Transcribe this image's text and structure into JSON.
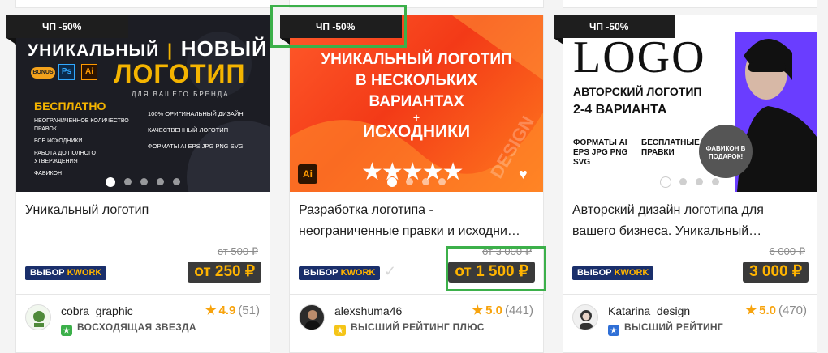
{
  "cards": [
    {
      "badge": "ЧП -50%",
      "cover": {
        "line1a": "УНИКАЛЬНЫЙ",
        "line1b": "НОВЫЙ",
        "line2": "ЛОГОТИП",
        "line3": "ДЛЯ ВАШЕГО БРЕНДА",
        "bonus": "BONUS",
        "free": "БЕСПЛАТНО",
        "left_items": [
          "НЕОГРАНИЧЕННОЕ КОЛИЧЕСТВО ПРАВОК",
          "ВСЕ ИСХОДНИКИ",
          "РАБОТА ДО ПОЛНОГО УТВЕРЖДЕНИЯ",
          "ФАВИКОН"
        ],
        "right_items": [
          "100% ОРИГИНАЛЬНЫЙ ДИЗАЙН",
          "КАЧЕСТВЕННЫЙ ЛОГОТИП",
          "ФОРМАТЫ AI EPS JPG PNG SVG"
        ]
      },
      "title": "Уникальный логотип",
      "old_price": "от 500 ₽",
      "price": "от 250 ₽",
      "choice_a": "ВЫБОР",
      "choice_b": "KWORK",
      "username": "cobra_graphic",
      "rating": "4.9",
      "reviews": "(51)",
      "level": "ВОСХОДЯЩАЯ ЗВЕЗДА"
    },
    {
      "badge": "ЧП -50%",
      "cover": {
        "line1": "УНИКАЛЬНЫЙ ЛОГОТИП",
        "line2": "В НЕСКОЛЬКИХ",
        "line3": "ВАРИАНТАХ",
        "plus": "+",
        "line4": "ИСХОДНИКИ",
        "ai": "Ai",
        "watermark": "DESIGN"
      },
      "title": "Разработка логотипа - неограниченные правки и исходни…",
      "old_price": "от 3 000 ₽",
      "price": "от 1 500 ₽",
      "choice_a": "ВЫБОР",
      "choice_b": "KWORK",
      "check": "✓",
      "username": "alexshuma46",
      "rating": "5.0",
      "reviews": "(441)",
      "level": "ВЫСШИЙ РЕЙТИНГ ПЛЮС"
    },
    {
      "badge": "ЧП -50%",
      "cover": {
        "logo": "LOGO",
        "author": "АВТОРСКИЙ ЛОГОТИП",
        "variants": "2-4 ВАРИАНТА",
        "formats": "ФОРМАТЫ AI EPS JPG PNG SVG",
        "edits": "БЕСПЛАТНЫЕ ПРАВКИ",
        "gift": "ФАВИКОН В ПОДАРОК!"
      },
      "title": "Авторский дизайн логотипа для вашего бизнеса. Уникальный…",
      "old_price": "6 000 ₽",
      "price": "3 000 ₽",
      "choice_a": "ВЫБОР",
      "choice_b": "KWORK",
      "username": "Katarina_design",
      "rating": "5.0",
      "reviews": "(470)",
      "level": "ВЫСШИЙ РЕЙТИНГ"
    }
  ],
  "colors": {
    "accent_price": "#ffb400",
    "choice_bg": "#1a2f6b",
    "star": "#f7a30d",
    "highlight": "#3cb04a",
    "level_rising": "#3cb04a",
    "level_plus": "#f5c518",
    "level_top": "#2f6fd6"
  }
}
